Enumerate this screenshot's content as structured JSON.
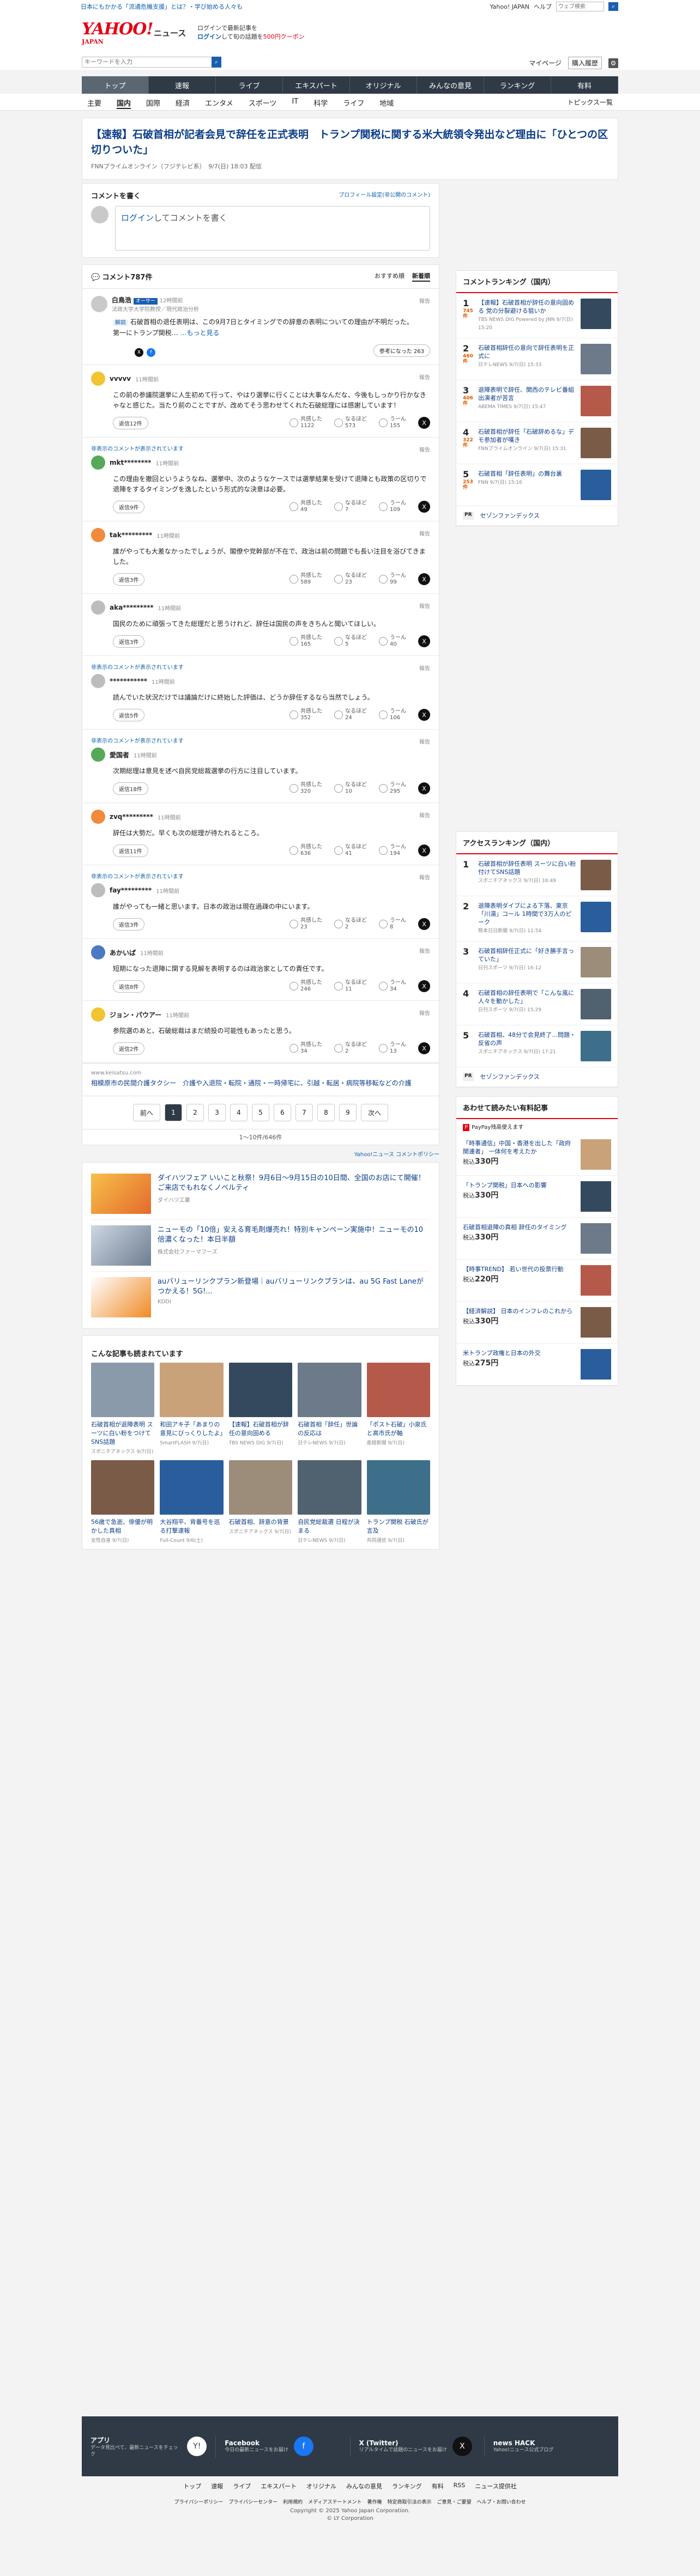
{
  "topline": {
    "left": "日本にもかかる「流通危機支援」とは？・学び始める人々も",
    "links": [
      "Yahoo! JAPAN",
      "ヘルプ"
    ],
    "search_placeholder": "ウェブ検索",
    "search_btn": "検索"
  },
  "header": {
    "logo": "YAHOO!",
    "logo_sub": "JAPAN",
    "news": "ニュース",
    "promo_line1": "ログインで最新記事を",
    "promo_login": "ログイン",
    "promo_line2": "して旬の話題を",
    "promo_red": "500円クーポン"
  },
  "search": {
    "placeholder": "キーワードを入力",
    "button": "検索",
    "mypage": "マイページ",
    "register": "購入履歴",
    "settings": "設定"
  },
  "nav": [
    "トップ",
    "速報",
    "ライブ",
    "エキスパート",
    "オリジナル",
    "みんなの意見",
    "ランキング",
    "有料"
  ],
  "subnav": [
    "主要",
    "国内",
    "国際",
    "経済",
    "エンタメ",
    "スポーツ",
    "IT",
    "科学",
    "ライフ",
    "地域"
  ],
  "subnav_right": "トピックス一覧",
  "article": {
    "title": "【速報】石破首相が記者会見で辞任を正式表明　トランプ関税に関する米大統領令発出など理由に「ひとつの区切りついた」",
    "meta": "FNNプライムオンライン（フジテレビ系）　9/7(日) 18:03 配信"
  },
  "comment_post": {
    "heading": "コメントを書く",
    "profile_link": "プロフィール設定(非公開のコメント)",
    "login": "ログイン",
    "placeholder_rest": "してコメントを書く"
  },
  "comments_bar": {
    "count": "コメント787件",
    "tab_recommended": "おすすめ順",
    "tab_newest": "新着順"
  },
  "expert": {
    "name": "白鳥浩",
    "badge": "オーサー",
    "time": "12時間前",
    "role": "法政大学大学院教授／現代政治分析",
    "report": "報告",
    "note_label": "解説",
    "body": "石破首相の退任表明は、この9月7日とタイミングでの辞意の表明についての理由が不明だった。",
    "body2": "第一にトランプ関税…",
    "more": "…もっと見る",
    "good": "参考になった 263"
  },
  "comments": [
    {
      "label": "",
      "name": "vvvvv",
      "time": "11時間前",
      "body": "この前の参議院選挙に人生初めて行って、やはり選挙に行くことは大事なんだな、今後もしっかり行かなきゃなと感じた。当たり前のことですが、改めてそう思わせてくれた石破総理には感謝しています！",
      "reply": "返信12件",
      "v1": "1122",
      "v2": "573",
      "v3": "155",
      "color": "yellow"
    },
    {
      "label": "非表示のコメントが表示されています",
      "name": "mkt********",
      "time": "11時間前",
      "body": "この理由を撤回というようなね、選挙中、次のようなケースでは選挙結果を受けて退陣とも政策の区切りで退陣をするタイミングを逸したという形式的な決意は必要。",
      "reply": "返信9件",
      "v1": "49",
      "v2": "7",
      "v3": "109",
      "color": "green"
    },
    {
      "label": "",
      "name": "tak*********",
      "time": "11時間前",
      "body": "誰がやっても大差なかったでしょうが、閣僚や党幹部が不在で、政治は前の問題でも長い注目を浴びてきました。",
      "reply": "返信3件",
      "v1": "589",
      "v2": "23",
      "v3": "99",
      "color": "orange"
    },
    {
      "label": "",
      "name": "aka*********",
      "time": "11時間前",
      "body": "国民のために頑張ってきた総理だと思うけれど、辞任は国民の声をきちんと聞いてほしい。",
      "reply": "返信3件",
      "v1": "165",
      "v2": "5",
      "v3": "40",
      "color": "gray"
    },
    {
      "label": "非表示のコメントが表示されています",
      "name": "***********",
      "time": "11時間前",
      "body": "読んでいた状況だけでは議論だけに終始した評価は、どうか辞任するなら当然でしょう。",
      "reply": "返信5件",
      "v1": "352",
      "v2": "24",
      "v3": "106",
      "color": "gray"
    },
    {
      "label": "非表示のコメントが表示されています",
      "name": "愛国者",
      "time": "11時間前",
      "body": "次期総理は意見を述べ自民党総裁選挙の行方に注目しています。",
      "reply": "返信18件",
      "v1": "320",
      "v2": "10",
      "v3": "295",
      "color": "green"
    },
    {
      "label": "",
      "name": "zvq*********",
      "time": "11時間前",
      "body": "辞任は大勢だ。早くも次の総理が待たれるところ。",
      "reply": "返信11件",
      "v1": "636",
      "v2": "41",
      "v3": "194",
      "color": "orange"
    },
    {
      "label": "非表示のコメントが表示されています",
      "name": "fay*********",
      "time": "11時間前",
      "body": "誰がやっても一緒と思います。日本の政治は現在過疎の中にいます。",
      "reply": "返信3件",
      "v1": "23",
      "v2": "2",
      "v3": "8",
      "color": "gray"
    },
    {
      "label": "",
      "name": "あかいぱ",
      "time": "11時間前",
      "body": "短期になった退陣に関する見解を表明するのは政治家としての責任です。",
      "reply": "返信8件",
      "v1": "246",
      "v2": "11",
      "v3": "34",
      "color": "blue"
    },
    {
      "label": "",
      "name": "ジョン・パウアー",
      "time": "11時間前",
      "body": "参院選のあと、石破総裁はまだ続投の可能性もあったと思う。",
      "reply": "返信2件",
      "v1": "34",
      "v2": "2",
      "v3": "13",
      "color": "yellow"
    }
  ],
  "vote_labels": [
    "共感した",
    "なるほど",
    "うーん"
  ],
  "reply_link_text": "報告",
  "sponsored": {
    "url": "www.keisatsu.com",
    "text": "相模原市の民間介護タクシー　介護や入退院・転院・通院・一時帰宅に、引越・転居・病院等移転などの介護"
  },
  "pager": {
    "prev": "前へ",
    "pages": [
      "1",
      "2",
      "3",
      "4",
      "5",
      "6",
      "7",
      "8",
      "9"
    ],
    "next": "次へ",
    "info": "1〜10件/646件"
  },
  "guideline": "Yahoo!ニュース コメントポリシー",
  "ads": [
    {
      "title": "ダイハツフェア いいこと秋祭！9月6日〜9月15日の10日間、全国のお店にて開催！ご来店でもれなくノベルティ",
      "src": "ダイハツ工業"
    },
    {
      "title": "ニューモの「10倍」安える育毛剤爆売れ！特別キャンペーン実施中！ニューモの10倍濃くなった！本日半額",
      "src": "株式会社ファーマフーズ"
    },
    {
      "title": "auバリューリンクプラン新登場｜auバリューリンクプランは、au 5G Fast Laneがつかえる！5G!...",
      "src": "KDDI"
    }
  ],
  "more_articles": {
    "title": "こんな記事も読まれています",
    "items": [
      {
        "t": "石破首相が退陣表明 スーツに白い粉をつけてSNS話題",
        "s": "スポニチアネックス 9/7(日)"
      },
      {
        "t": "和田アキ子「あまりの意見にびっくりしたよ」",
        "s": "SmartFLASH 9/7(日)"
      },
      {
        "t": "【速報】石破首相が辞任の意向固める",
        "s": "TBS NEWS DIG 9/7(日)"
      },
      {
        "t": "石破首相「辞任」世論の反応は",
        "s": "日テレNEWS 9/7(日)"
      },
      {
        "t": "「ポスト石破」小泉氏と高市氏が軸",
        "s": "産経新聞 9/7(日)"
      },
      {
        "t": "56歳で急逝、俳優が明かした真相",
        "s": "女性自身 9/7(日)"
      },
      {
        "t": "大谷翔平、背番号を巡る打撃速報",
        "s": "Full-Count 9/6(土)"
      },
      {
        "t": "石破首相、辞意の背景",
        "s": "スポニチアネックス 9/7(日)"
      },
      {
        "t": "自民党総裁選 日程が決まる",
        "s": "日テレNEWS 9/7(日)"
      },
      {
        "t": "トランプ関税 石破氏が言及",
        "s": "共同通信 9/7(日)"
      }
    ]
  },
  "ranking": {
    "title": "コメントランキング（国内）",
    "items": [
      {
        "n": "1",
        "c": "745件",
        "t": "【速報】石破首相が辞任の意向固める 党の分裂避ける狙いか",
        "s": "TBS NEWS DIG Powered by JNN 9/7(日) 15:20"
      },
      {
        "n": "2",
        "c": "460件",
        "t": "石破首相辞任の意向で辞任表明を正式に",
        "s": "日テレNEWS 9/7(日) 15:33"
      },
      {
        "n": "3",
        "c": "406件",
        "t": "退陣表明で辞任、関西のテレビ番組出演者が苦言",
        "s": "ABEMA TIMES 9/7(日) 15:47"
      },
      {
        "n": "4",
        "c": "322件",
        "t": "石破首相が辞任「石破辞めるな」デモ参加者が嘆き",
        "s": "FNNプライムオンライン 9/7(日) 15:31"
      },
      {
        "n": "5",
        "c": "253件",
        "t": "石破首相「辞任表明」の舞台裏 ",
        "s": "FNN 9/7(日) 15:16"
      }
    ],
    "pr": "セゾンファンデックス"
  },
  "access_ranking": {
    "title": "アクセスランキング（国内）",
    "items": [
      {
        "n": "1",
        "t": "石破首相が辞任表明 スーツに白い粉付けてSNS話題",
        "s": "スポニチアネックス 9/7(日) 16:49"
      },
      {
        "n": "2",
        "t": "退陣表明ダイブによる下落、東京「川湯」コール 1時間で3万人のピーク",
        "s": "熊本日日新聞 9/7(日) 11:54"
      },
      {
        "n": "3",
        "t": "石破首相辞任正式に「好き勝手言っていた」",
        "s": "日刊スポーツ 9/7(日) 16:12"
      },
      {
        "n": "4",
        "t": "石破首相の辞任表明で「こんな風に人々を動かした」",
        "s": "日刊スポーツ 9/7(日) 15:29"
      },
      {
        "n": "5",
        "t": "石破首相、48分で会見終了…問題・反省の声",
        "s": "スポニチアネックス 9/7(日) 17:21"
      }
    ],
    "pr": "セゾンファンデックス"
  },
  "shopping": {
    "title": "あわせて読みたい有料記事",
    "label": "PayPay残高使えます",
    "items": [
      {
        "t": "「時事通信」中国・香港を出した「政府関連者」 一体何を考えたか",
        "p": "税込",
        "price": "330円"
      },
      {
        "t": "「トランプ関税」日本への影響",
        "p": "税込",
        "price": "330円"
      },
      {
        "t": "石破首相退陣の真相 辞任のタイミング",
        "p": "税込",
        "price": "330円"
      },
      {
        "t": "【時事TREND】 若い世代の投票行動",
        "p": "税込",
        "price": "220円"
      },
      {
        "t": "【経済解説】 日本のインフレのこれから",
        "p": "税込",
        "price": "330円"
      },
      {
        "t": "米トランプ政権と日本の外交",
        "p": "税込",
        "price": "275円"
      }
    ]
  },
  "footer": {
    "blocks": [
      {
        "t": "アプリ",
        "d": "データ見比べて、最新ニュースをチェック"
      },
      {
        "t": "Facebook",
        "d": "今日の最新ニュースをお届け"
      },
      {
        "t": "X (Twitter)",
        "d": "リアルタイムで話題のニュースをお届け"
      },
      {
        "t": "news HACK",
        "d": "Yahoo!ニュース公式ブログ"
      }
    ],
    "links": [
      "トップ",
      "速報",
      "ライブ",
      "エキスパート",
      "オリジナル",
      "みんなの意見",
      "ランキング",
      "有料",
      "RSS",
      "ニュース提供社"
    ],
    "legal": [
      "プライバシーポリシー",
      "プライバシーセンター",
      "利用規約",
      "メディアステートメント",
      "著作権",
      "特定商取引法の表示",
      "ご意見・ご要望",
      "ヘルプ・お問い合わせ"
    ],
    "copyright": "Copyright © 2025 Yahoo Japan Corporation.",
    "copyright2": "© LY Corporation"
  }
}
